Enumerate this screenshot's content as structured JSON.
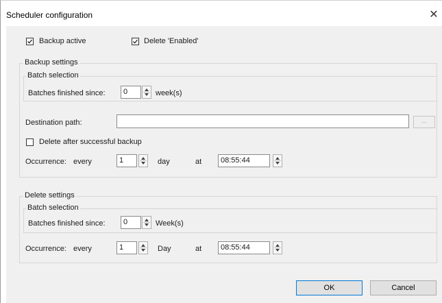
{
  "window": {
    "title": "Scheduler configuration",
    "close_glyph": "✕"
  },
  "top": {
    "backup_active": {
      "label": "Backup active",
      "checked": true
    },
    "delete_enabled": {
      "label": "Delete 'Enabled'",
      "checked": true
    }
  },
  "backup": {
    "title": "Backup settings",
    "batch_group_title": "Batch selection",
    "batches_label": "Batches finished since:",
    "batches_value": "0",
    "batches_unit": "week(s)",
    "destination_label": "Destination path:",
    "destination_value": "",
    "browse_label": "...",
    "delete_after": {
      "label": "Delete after successful backup",
      "checked": false
    },
    "occurrence_label": "Occurrence:",
    "every_label": "every",
    "every_value": "1",
    "unit": "day",
    "at_label": "at",
    "time_value": "08:55:44"
  },
  "delete": {
    "title": "Delete settings",
    "batch_group_title": "Batch selection",
    "batches_label": "Batches finished since:",
    "batches_value": "0",
    "batches_unit": "Week(s)",
    "occurrence_label": "Occurrence:",
    "every_label": "every",
    "every_value": "1",
    "unit": "Day",
    "at_label": "at",
    "time_value": "08:55:44"
  },
  "buttons": {
    "ok": "OK",
    "cancel": "Cancel"
  }
}
